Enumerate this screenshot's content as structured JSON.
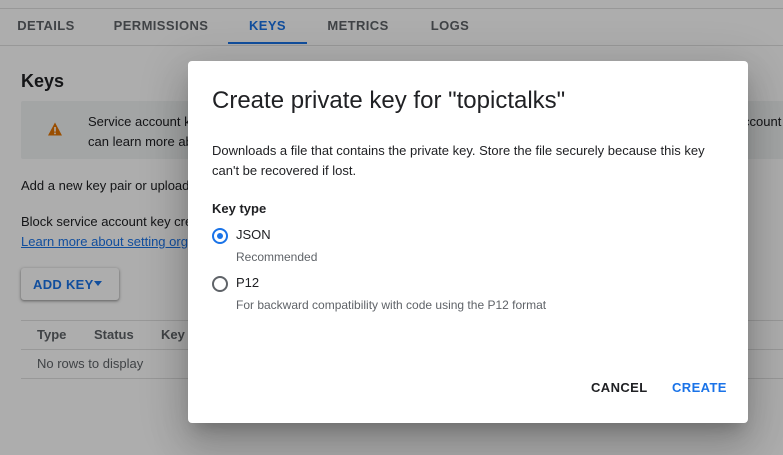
{
  "tabs": [
    {
      "label": "DETAILS"
    },
    {
      "label": "PERMISSIONS"
    },
    {
      "label": "KEYS"
    },
    {
      "label": "METRICS"
    },
    {
      "label": "LOGS"
    }
  ],
  "active_tab": "KEYS",
  "keys_section": {
    "title": "Keys",
    "banner": {
      "icon": "warning-icon",
      "line1_left": "Service account k",
      "line1_right": "ccount",
      "line2": "can learn more ab"
    },
    "add_key_text": "Add a new key pair or upload",
    "block_text": "Block service account key cre",
    "learn_more_link": "Learn more about setting org",
    "add_key_button": "ADD KEY",
    "table": {
      "columns": [
        "Type",
        "Status",
        "Key"
      ],
      "empty_message": "No rows to display"
    }
  },
  "dialog": {
    "title": "Create private key for \"topictalks\"",
    "description": "Downloads a file that contains the private key. Store the file securely because this key can't be recovered if lost.",
    "key_type_label": "Key type",
    "options": [
      {
        "label": "JSON",
        "sublabel": "Recommended",
        "checked": true
      },
      {
        "label": "P12",
        "sublabel": "For backward compatibility with code using the P12 format",
        "checked": false
      }
    ],
    "cancel_label": "CANCEL",
    "create_label": "CREATE"
  },
  "colors": {
    "accent": "#1a73e8",
    "warning": "#e37400",
    "scrim": "rgba(0,0,0,0.32)"
  }
}
